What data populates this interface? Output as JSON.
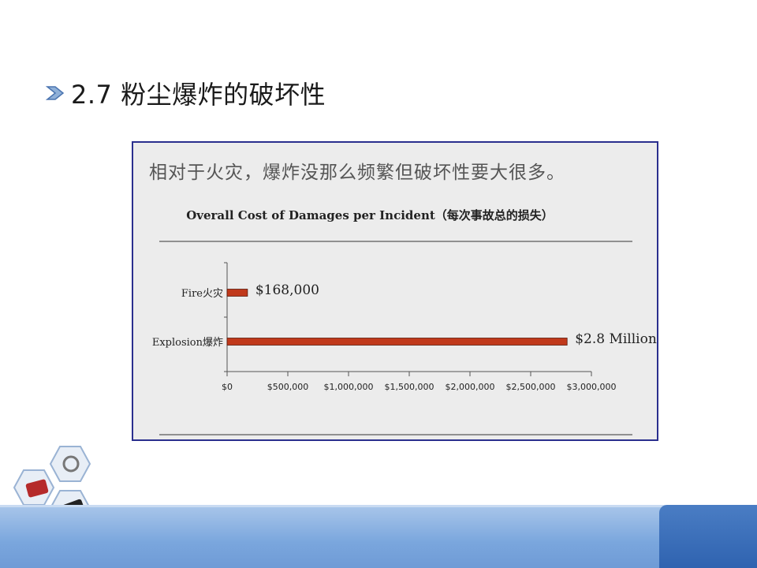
{
  "slide": {
    "title": "2.7 粉尘爆炸的破坏性"
  },
  "figure": {
    "subtitle": "相对于火灾，爆炸没那么频繁但破坏性要大很多。"
  },
  "colors": {
    "bar": "#c0391b",
    "frame": "#2a2f8e",
    "panel": "#ececec",
    "band": "#7aa6dd"
  },
  "chart_data": {
    "type": "bar",
    "orientation": "horizontal",
    "title": "Overall Cost of Damages per Incident（每次事故总的损失）",
    "categories": [
      "Fire火灾",
      "Explosion爆炸"
    ],
    "values": [
      168000,
      2800000
    ],
    "data_labels": [
      "$168,000",
      "$2.8 Million"
    ],
    "xlim": [
      0,
      3000000
    ],
    "xticks": [
      0,
      500000,
      1000000,
      1500000,
      2000000,
      2500000,
      3000000
    ],
    "xtick_labels": [
      "$0",
      "$500,000",
      "$1,000,000",
      "$1,500,000",
      "$2,000,000",
      "$2,500,000",
      "$3,000,000"
    ],
    "grid": false,
    "legend": "none"
  }
}
